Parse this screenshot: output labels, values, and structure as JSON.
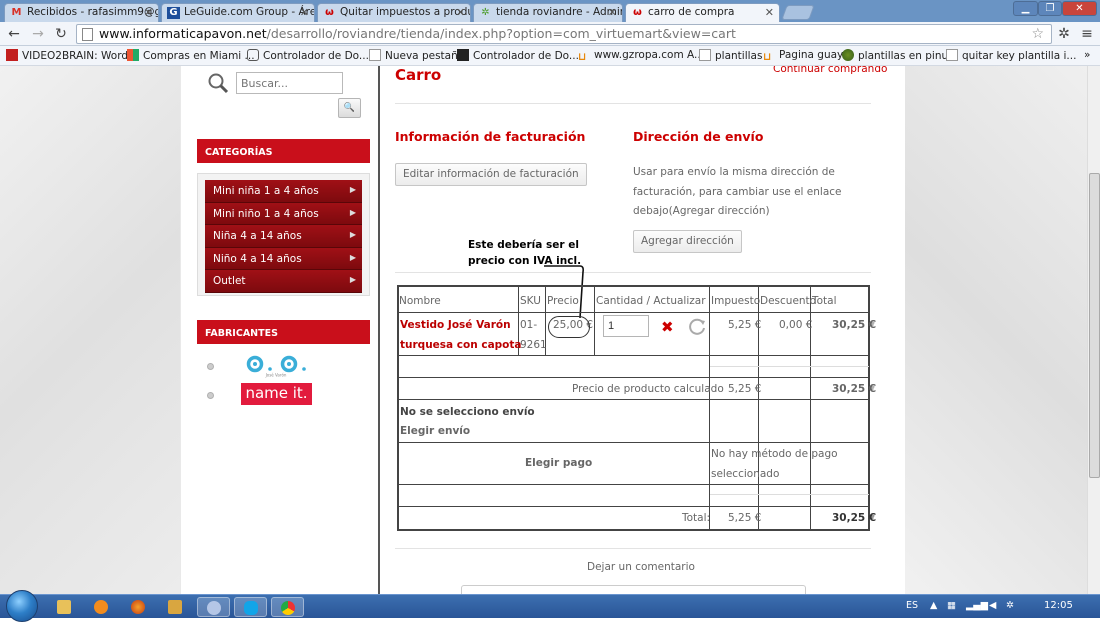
{
  "browser": {
    "tabs": [
      {
        "label": "Recibidos - rafasimm9@g",
        "favicon": "gmail-icon",
        "color": "#d93025"
      },
      {
        "label": "LeGuide.com Group - Áre",
        "favicon": "leguide-icon",
        "color": "#1e4f9b"
      },
      {
        "label": "Quitar impuestos a produ",
        "favicon": "virtuemart-icon",
        "color": "#c00"
      },
      {
        "label": "tienda roviandre - Admin",
        "favicon": "joomla-icon",
        "color": "#4d9d2a"
      },
      {
        "label": "carro de compra",
        "favicon": "virtuemart-icon",
        "color": "#c00"
      }
    ],
    "url_host": "www.informaticapavon.net",
    "url_path": "/desarrollo/roviandre/tienda/index.php?option=com_virtuemart&view=cart",
    "bookmarks": [
      "VIDEO2BRAIN: Word...",
      "Compras en Miami ...",
      "Controlador de Do...",
      "Nueva pestaña",
      "Controlador de Do...",
      "www.gzropa.com A...",
      "plantillas",
      "Pagina guay",
      "plantillas en pinus",
      "quitar key plantilla i..."
    ],
    "bookmarks_overflow": "»"
  },
  "sidebar": {
    "search_placeholder": "Buscar...",
    "categories_header": "CATEGORÍAS",
    "categories": [
      "Mini niña 1 a 4 años",
      "Mini niño 1 a 4 años",
      "Niña 4 a 14 años",
      "Niño 4 a 14 años",
      "Outlet"
    ],
    "manufacturers_header": "FABRICANTES",
    "manufacturers": [
      "José Varón",
      "name it."
    ]
  },
  "cart": {
    "title": "Carro",
    "continue_link": "Continuar comprando",
    "billing_title": "Información de facturación",
    "billing_button": "Editar información de facturación",
    "shipping_title": "Dirección de envío",
    "shipping_text": "Usar para envío la misma dirección de facturación, para cambiar use el enlace debajo(Agregar dirección)",
    "shipping_button": "Agregar dirección",
    "annotation_line1": "Este debería ser el",
    "annotation_line2": "precio con IVA incl.",
    "columns": [
      "Nombre",
      "SKU",
      "Precio",
      "Cantidad / Actualizar",
      "Impuesto",
      "Descuento",
      "Total"
    ],
    "item": {
      "name_line1": "Vestido José Varón",
      "name_line2": "turquesa con capota",
      "sku_line1": "01-",
      "sku_line2": "9261",
      "price": "25,00 €",
      "quantity": "1",
      "tax": "5,25 €",
      "discount": "0,00 €",
      "total": "30,25 €"
    },
    "calculated_label": "Precio de producto calculado",
    "calculated_tax": "5,25 €",
    "calculated_total": "30,25 €",
    "shipping_status": "No se selecciono envío",
    "choose_shipping": "Elegir envío",
    "choose_payment": "Elegir pago",
    "payment_status_line1": "No hay método de pago",
    "payment_status_line2": "seleccionado",
    "total_label": "Total:",
    "total_tax": "5,25 €",
    "total_amount": "30,25 €",
    "comment_label": "Dejar un comentario"
  },
  "taskbar": {
    "language": "ES",
    "clock": "12:05"
  }
}
